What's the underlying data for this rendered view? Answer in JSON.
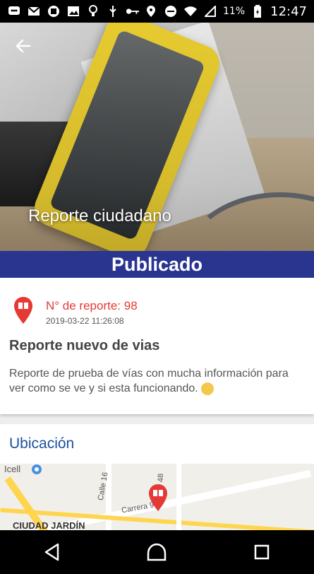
{
  "status_bar": {
    "battery_text": "11%",
    "time": "12:47"
  },
  "header": {
    "title": "Reporte ciudadano",
    "back_icon": "arrow-left-icon"
  },
  "status_band": {
    "label": "Publicado"
  },
  "report": {
    "number_label": "N° de reporte: 98",
    "date": "2019-03-22 11:26:08",
    "title": "Reporte nuevo de vias",
    "description": "Reporte de prueba de vías con mucha información para ver como se ve y si esta funcionando."
  },
  "location": {
    "label": "Ubicación"
  },
  "map": {
    "labels": {
      "poi": "Icell",
      "street_1": "Calle 16",
      "street_2": "Carrera 99",
      "street_3": "48",
      "district": "CIUDAD JARDÍN"
    }
  },
  "colors": {
    "accent_band": "#2a3590",
    "report_red": "#e53935",
    "location_blue": "#1c4fa1"
  }
}
